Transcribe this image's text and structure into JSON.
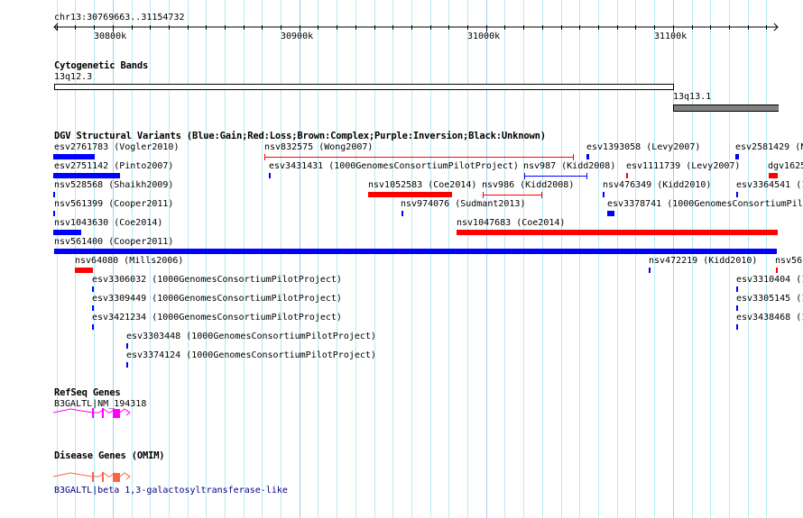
{
  "ruler": {
    "position": "chr13:30769663..31154732",
    "ticks": [
      "30800k",
      "30900k",
      "31000k",
      "31100k"
    ]
  },
  "tracks": {
    "cytoband": {
      "title": "Cytogenetic Bands",
      "bands": [
        {
          "name": "13q12.3",
          "stain": "gneg"
        },
        {
          "name": "13q13.1",
          "stain": "gpos50"
        }
      ]
    },
    "dgv": {
      "title": "DGV Structural Variants (Blue:Gain;Red:Loss;Brown:Complex;Purple:Inversion;Black:Unknown)",
      "features": [
        {
          "label": "esv2761783 (Vogler2010)",
          "type": "gain"
        },
        {
          "label": "nsv832575 (Wong2007)",
          "type": "loss"
        },
        {
          "label": "esv1393058 (Levy2007)",
          "type": "gain"
        },
        {
          "label": "esv2581429 (N",
          "type": "gain"
        },
        {
          "label": "esv2751142 (Pinto2007)",
          "type": "gain"
        },
        {
          "label": "esv3431431 (1000GenomesConsortiumPilotProject)",
          "type": "gain"
        },
        {
          "label": "nsv987 (Kidd2008)",
          "type": "gain"
        },
        {
          "label": "esv1111739 (Levy2007)",
          "type": "loss"
        },
        {
          "label": "dgv1625",
          "type": "loss"
        },
        {
          "label": "nsv528568 (Shaikh2009)",
          "type": "gain"
        },
        {
          "label": "nsv1052583 (Coe2014)",
          "type": "loss"
        },
        {
          "label": "nsv986 (Kidd2008)",
          "type": "loss"
        },
        {
          "label": "nsv476349 (Kidd2010)",
          "type": "gain"
        },
        {
          "label": "esv3364541 (1",
          "type": "gain"
        },
        {
          "label": "nsv561399 (Cooper2011)",
          "type": "gain"
        },
        {
          "label": "nsv974076 (Sudmant2013)",
          "type": "gain"
        },
        {
          "label": "esv3378741 (1000GenomesConsortiumPilo",
          "type": "gain"
        },
        {
          "label": "nsv1043630 (Coe2014)",
          "type": "gain"
        },
        {
          "label": "nsv1047683 (Coe2014)",
          "type": "loss"
        },
        {
          "label": "nsv561400 (Cooper2011)",
          "type": "gain"
        },
        {
          "label": "nsv64080 (Mills2006)",
          "type": "loss"
        },
        {
          "label": "nsv472219 (Kidd2010)",
          "type": "gain"
        },
        {
          "label": "nsv56",
          "type": "loss"
        },
        {
          "label": "esv3306032 (1000GenomesConsortiumPilotProject)",
          "type": "gain"
        },
        {
          "label": "esv3310404 (1",
          "type": "gain"
        },
        {
          "label": "esv3309449 (1000GenomesConsortiumPilotProject)",
          "type": "gain"
        },
        {
          "label": "esv3305145 (1",
          "type": "gain"
        },
        {
          "label": "esv3421234 (1000GenomesConsortiumPilotProject)",
          "type": "gain"
        },
        {
          "label": "esv3438468 (1",
          "type": "gain"
        },
        {
          "label": "esv3303448 (1000GenomesConsortiumPilotProject)",
          "type": "gain"
        },
        {
          "label": "esv3374124 (1000GenomesConsortiumPilotProject)",
          "type": "gain"
        }
      ]
    },
    "refseq": {
      "title": "RefSeq Genes",
      "gene_label": "B3GALTL|NM_194318"
    },
    "omim": {
      "title": "Disease Genes (OMIM)",
      "gene_label": "B3GALTL|beta 1,3-galactosyltransferase-like"
    }
  },
  "colors": {
    "gain": "#0000ff",
    "loss": "#ff0000",
    "refseq": "#ff00ff",
    "omim": "#ff6347",
    "omim_label": "#000080",
    "grid": "#b4eaf0",
    "grid_major": "#9fd0ee",
    "band_gpos50": "#808080"
  }
}
